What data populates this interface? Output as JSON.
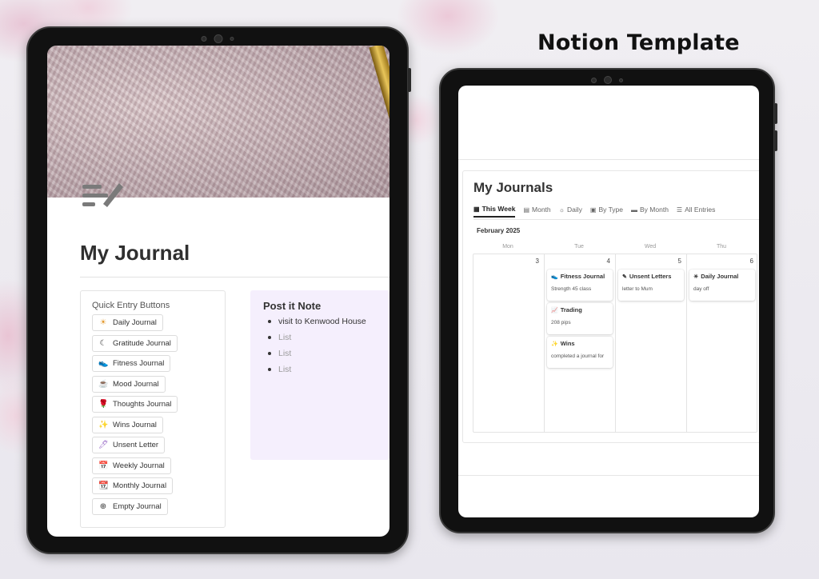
{
  "banner": {
    "title": "Notion Template"
  },
  "left": {
    "page_title": "My Journal",
    "quick_entry": {
      "heading": "Quick Entry Buttons",
      "buttons": [
        {
          "label": "Daily Journal",
          "icon": "sun-icon",
          "glyph": "☀",
          "color": "#e39a2f"
        },
        {
          "label": "Gratitude Journal",
          "icon": "moon-icon",
          "glyph": "☾",
          "color": "#333333"
        },
        {
          "label": "Fitness Journal",
          "icon": "sneaker-icon",
          "glyph": "👟",
          "color": "#8a5bbf"
        },
        {
          "label": "Mood Journal",
          "icon": "coffee-cup-icon",
          "glyph": "☕",
          "color": "#8b4a2b"
        },
        {
          "label": "Thoughts Journal",
          "icon": "rose-icon",
          "glyph": "🌹",
          "color": "#d23c3c"
        },
        {
          "label": "Wins Journal",
          "icon": "sparkles-icon",
          "glyph": "✨",
          "color": "#c65c9a"
        },
        {
          "label": "Unsent Letter",
          "icon": "feather-pen-icon",
          "glyph": "🖊",
          "color": "#9a6cc8"
        },
        {
          "label": "Weekly Journal",
          "icon": "calendar-week-icon",
          "glyph": "📅",
          "color": "#3a83c9"
        },
        {
          "label": "Monthly Journal",
          "icon": "calendar-month-icon",
          "glyph": "📆",
          "color": "#3f9a5a"
        },
        {
          "label": "Empty Journal",
          "icon": "plus-circle-icon",
          "glyph": "⊕",
          "color": "#333333"
        }
      ]
    },
    "post_it": {
      "title": "Post it Note",
      "items": [
        "visit to Kenwood House"
      ],
      "placeholders": [
        "List",
        "List",
        "List"
      ]
    }
  },
  "right": {
    "title": "My Journals",
    "tabs": [
      {
        "label": "This Week",
        "icon": "calendar-icon",
        "glyph": "▦",
        "active": true
      },
      {
        "label": "Month",
        "icon": "calendar-icon",
        "glyph": "▤",
        "active": false
      },
      {
        "label": "Daily",
        "icon": "sun-icon",
        "glyph": "☼",
        "active": false
      },
      {
        "label": "By Type",
        "icon": "grid-icon",
        "glyph": "▣",
        "active": false
      },
      {
        "label": "By Month",
        "icon": "archive-icon",
        "glyph": "▬",
        "active": false
      },
      {
        "label": "All Entries",
        "icon": "checklist-icon",
        "glyph": "☰",
        "active": false
      }
    ],
    "month_label": "February 2025",
    "weekdays": [
      "Mon",
      "Tue",
      "Wed",
      "Thu"
    ],
    "days": [
      "3",
      "4",
      "5",
      "6"
    ],
    "events": [
      {
        "day": 1,
        "title": "Fitness Journal",
        "detail": "Strength 45 class",
        "icon": "sneaker-icon",
        "glyph": "👟"
      },
      {
        "day": 1,
        "title": "Trading",
        "detail": "208 pips",
        "icon": "chart-icon",
        "glyph": "📈"
      },
      {
        "day": 1,
        "title": "Wins",
        "detail": "completed a journal for",
        "icon": "sparkles-icon",
        "glyph": "✨"
      },
      {
        "day": 2,
        "title": "Unsent Letters",
        "detail": "letter to Mum",
        "icon": "pen-icon",
        "glyph": "✎"
      },
      {
        "day": 3,
        "title": "Daily Journal",
        "detail": "day off",
        "icon": "sun-icon",
        "glyph": "☀"
      }
    ]
  }
}
